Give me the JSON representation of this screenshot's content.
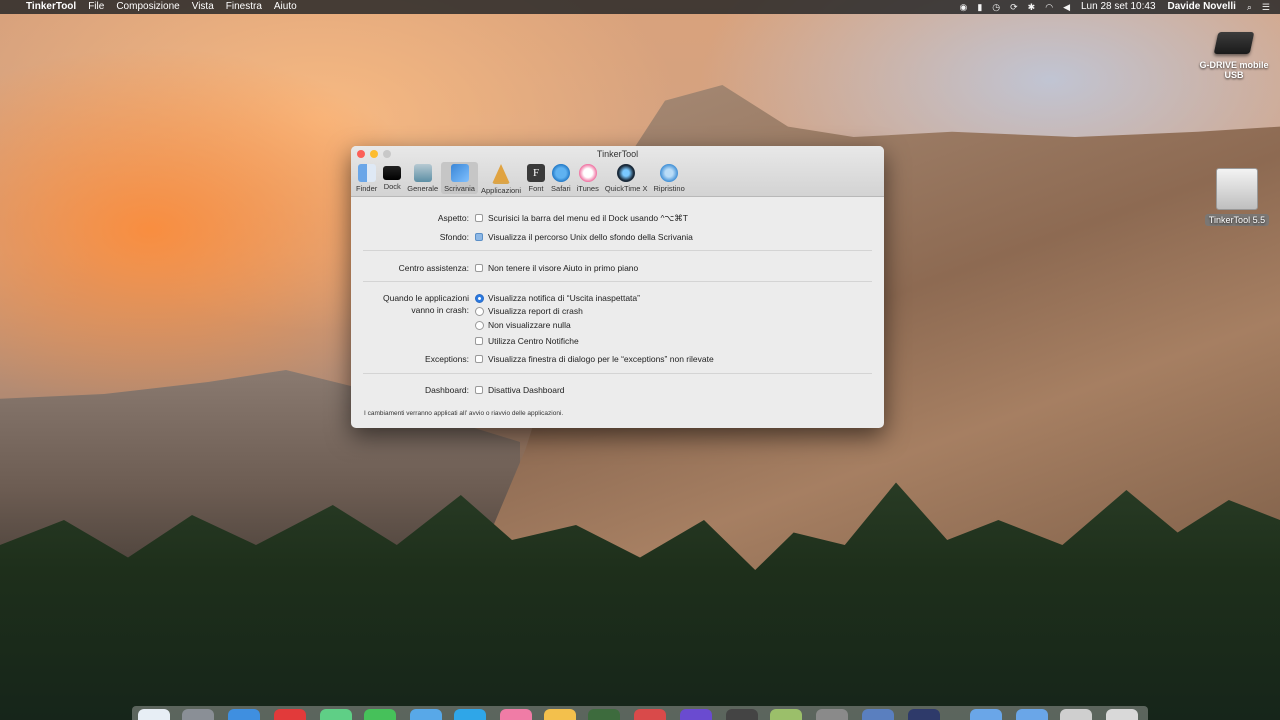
{
  "menubar": {
    "app_name": "TinkerTool",
    "menus": [
      "File",
      "Composizione",
      "Vista",
      "Finestra",
      "Aiuto"
    ],
    "clock": "Lun 28 set  10:43",
    "user": "Davide Novelli"
  },
  "desktop": {
    "drive_label": "G-DRIVE mobile USB",
    "disk_label": "TinkerTool 5.5"
  },
  "window": {
    "title": "TinkerTool",
    "toolbar": [
      {
        "label": "Finder",
        "icon": "finder-icon"
      },
      {
        "label": "Dock",
        "icon": "dock-icon"
      },
      {
        "label": "Generale",
        "icon": "generale-icon"
      },
      {
        "label": "Scrivania",
        "icon": "scrivania-icon",
        "selected": true
      },
      {
        "label": "Applicazioni",
        "icon": "applicazioni-icon"
      },
      {
        "label": "Font",
        "icon": "font-icon"
      },
      {
        "label": "Safari",
        "icon": "safari-icon"
      },
      {
        "label": "iTunes",
        "icon": "itunes-icon"
      },
      {
        "label": "QuickTime X",
        "icon": "quicktime-icon"
      },
      {
        "label": "Ripristino",
        "icon": "ripristino-icon"
      }
    ],
    "font_icon_glyph": "F",
    "aspetto": {
      "label": "Aspetto:",
      "option": "Scurisici la barra del menu ed il Dock usando ^⌥⌘T",
      "checked": false
    },
    "sfondo": {
      "label": "Sfondo:",
      "option": "Visualizza il percorso Unix dello sfondo della Scrivania",
      "checked": false
    },
    "centro": {
      "label": "Centro assistenza:",
      "option": "Non tenere il visore Aiuto in primo piano",
      "checked": false
    },
    "crash": {
      "label_line1": "Quando le applicazioni",
      "label_line2": "vanno in crash:",
      "options": [
        {
          "label": "Visualizza notifica di  “Uscita inaspettata”",
          "selected": true
        },
        {
          "label": "Visualizza report di crash",
          "selected": false
        },
        {
          "label": "Non visualizzare nulla",
          "selected": false
        }
      ],
      "centro_notifiche": {
        "label": "Utilizza Centro Notifiche",
        "checked": false
      }
    },
    "exceptions": {
      "label": "Exceptions:",
      "option": "Visualizza finestra di dialogo per le “exceptions” non rilevate",
      "checked": false
    },
    "dashboard": {
      "label": "Dashboard:",
      "option": "Disattiva Dashboard",
      "checked": false
    },
    "footer": "I cambiamenti verranno applicati all’ avvio o riavvio delle applicazioni."
  },
  "colors": {
    "accent": "#2a7ae2",
    "close": "#fc5f57",
    "minimize": "#fdbc2e"
  }
}
